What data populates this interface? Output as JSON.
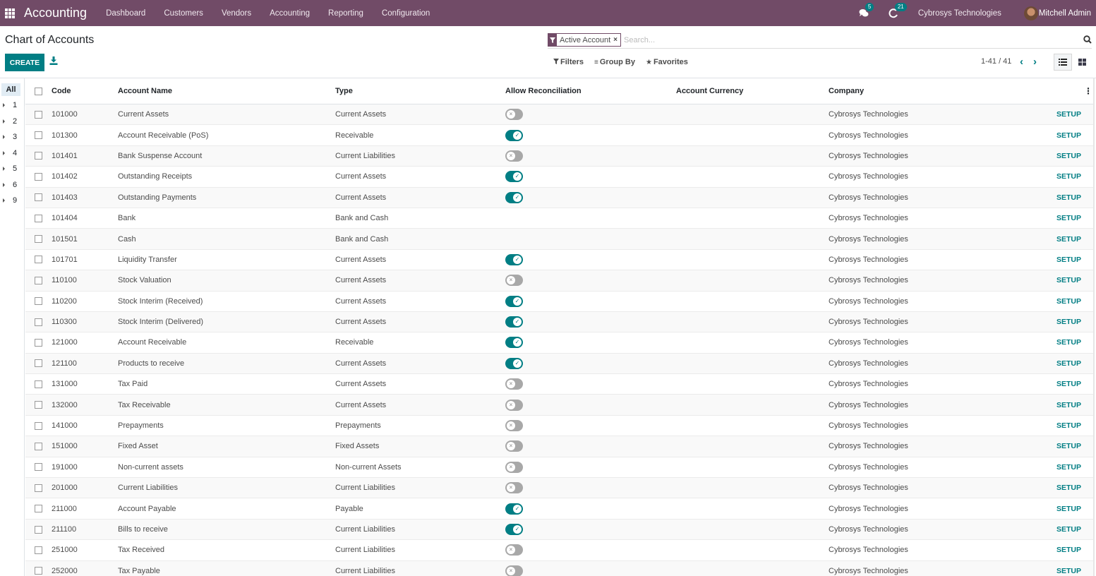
{
  "navbar": {
    "app_title": "Accounting",
    "menu": [
      "Dashboard",
      "Customers",
      "Vendors",
      "Accounting",
      "Reporting",
      "Configuration"
    ],
    "messages_count": "5",
    "activities_count": "21",
    "company": "Cybrosys Technologies",
    "user": "Mitchell Admin",
    "brand_color": "#714B67"
  },
  "control_panel": {
    "title": "Chart of Accounts",
    "create_label": "CREATE",
    "search": {
      "facet_value": "Active Account",
      "placeholder": "Search..."
    },
    "filters_label": "Filters",
    "group_by_label": "Group By",
    "favorites_label": "Favorites",
    "pager": "1-41 / 41"
  },
  "searchpanel": {
    "all_label": "All",
    "groups": [
      "1",
      "2",
      "3",
      "4",
      "5",
      "6",
      "9"
    ]
  },
  "table": {
    "accent_color": "#017e84",
    "columns": {
      "code": "Code",
      "name": "Account Name",
      "type": "Type",
      "reconcile": "Allow Reconciliation",
      "currency": "Account Currency",
      "company": "Company"
    },
    "setup_label": "SETUP",
    "rows": [
      {
        "code": "101000",
        "name": "Current Assets",
        "type": "Current Assets",
        "reconcile": false,
        "currency": "",
        "company": "Cybrosys Technologies"
      },
      {
        "code": "101300",
        "name": "Account Receivable (PoS)",
        "type": "Receivable",
        "reconcile": true,
        "currency": "",
        "company": "Cybrosys Technologies"
      },
      {
        "code": "101401",
        "name": "Bank Suspense Account",
        "type": "Current Liabilities",
        "reconcile": false,
        "currency": "",
        "company": "Cybrosys Technologies"
      },
      {
        "code": "101402",
        "name": "Outstanding Receipts",
        "type": "Current Assets",
        "reconcile": true,
        "currency": "",
        "company": "Cybrosys Technologies"
      },
      {
        "code": "101403",
        "name": "Outstanding Payments",
        "type": "Current Assets",
        "reconcile": true,
        "currency": "",
        "company": "Cybrosys Technologies"
      },
      {
        "code": "101404",
        "name": "Bank",
        "type": "Bank and Cash",
        "reconcile": null,
        "currency": "",
        "company": "Cybrosys Technologies"
      },
      {
        "code": "101501",
        "name": "Cash",
        "type": "Bank and Cash",
        "reconcile": null,
        "currency": "",
        "company": "Cybrosys Technologies"
      },
      {
        "code": "101701",
        "name": "Liquidity Transfer",
        "type": "Current Assets",
        "reconcile": true,
        "currency": "",
        "company": "Cybrosys Technologies"
      },
      {
        "code": "110100",
        "name": "Stock Valuation",
        "type": "Current Assets",
        "reconcile": false,
        "currency": "",
        "company": "Cybrosys Technologies"
      },
      {
        "code": "110200",
        "name": "Stock Interim (Received)",
        "type": "Current Assets",
        "reconcile": true,
        "currency": "",
        "company": "Cybrosys Technologies"
      },
      {
        "code": "110300",
        "name": "Stock Interim (Delivered)",
        "type": "Current Assets",
        "reconcile": true,
        "currency": "",
        "company": "Cybrosys Technologies"
      },
      {
        "code": "121000",
        "name": "Account Receivable",
        "type": "Receivable",
        "reconcile": true,
        "currency": "",
        "company": "Cybrosys Technologies"
      },
      {
        "code": "121100",
        "name": "Products to receive",
        "type": "Current Assets",
        "reconcile": true,
        "currency": "",
        "company": "Cybrosys Technologies"
      },
      {
        "code": "131000",
        "name": "Tax Paid",
        "type": "Current Assets",
        "reconcile": false,
        "currency": "",
        "company": "Cybrosys Technologies"
      },
      {
        "code": "132000",
        "name": "Tax Receivable",
        "type": "Current Assets",
        "reconcile": false,
        "currency": "",
        "company": "Cybrosys Technologies"
      },
      {
        "code": "141000",
        "name": "Prepayments",
        "type": "Prepayments",
        "reconcile": false,
        "currency": "",
        "company": "Cybrosys Technologies"
      },
      {
        "code": "151000",
        "name": "Fixed Asset",
        "type": "Fixed Assets",
        "reconcile": false,
        "currency": "",
        "company": "Cybrosys Technologies"
      },
      {
        "code": "191000",
        "name": "Non-current assets",
        "type": "Non-current Assets",
        "reconcile": false,
        "currency": "",
        "company": "Cybrosys Technologies"
      },
      {
        "code": "201000",
        "name": "Current Liabilities",
        "type": "Current Liabilities",
        "reconcile": false,
        "currency": "",
        "company": "Cybrosys Technologies"
      },
      {
        "code": "211000",
        "name": "Account Payable",
        "type": "Payable",
        "reconcile": true,
        "currency": "",
        "company": "Cybrosys Technologies"
      },
      {
        "code": "211100",
        "name": "Bills to receive",
        "type": "Current Liabilities",
        "reconcile": true,
        "currency": "",
        "company": "Cybrosys Technologies"
      },
      {
        "code": "251000",
        "name": "Tax Received",
        "type": "Current Liabilities",
        "reconcile": false,
        "currency": "",
        "company": "Cybrosys Technologies"
      },
      {
        "code": "252000",
        "name": "Tax Payable",
        "type": "Current Liabilities",
        "reconcile": false,
        "currency": "",
        "company": "Cybrosys Technologies"
      }
    ]
  }
}
